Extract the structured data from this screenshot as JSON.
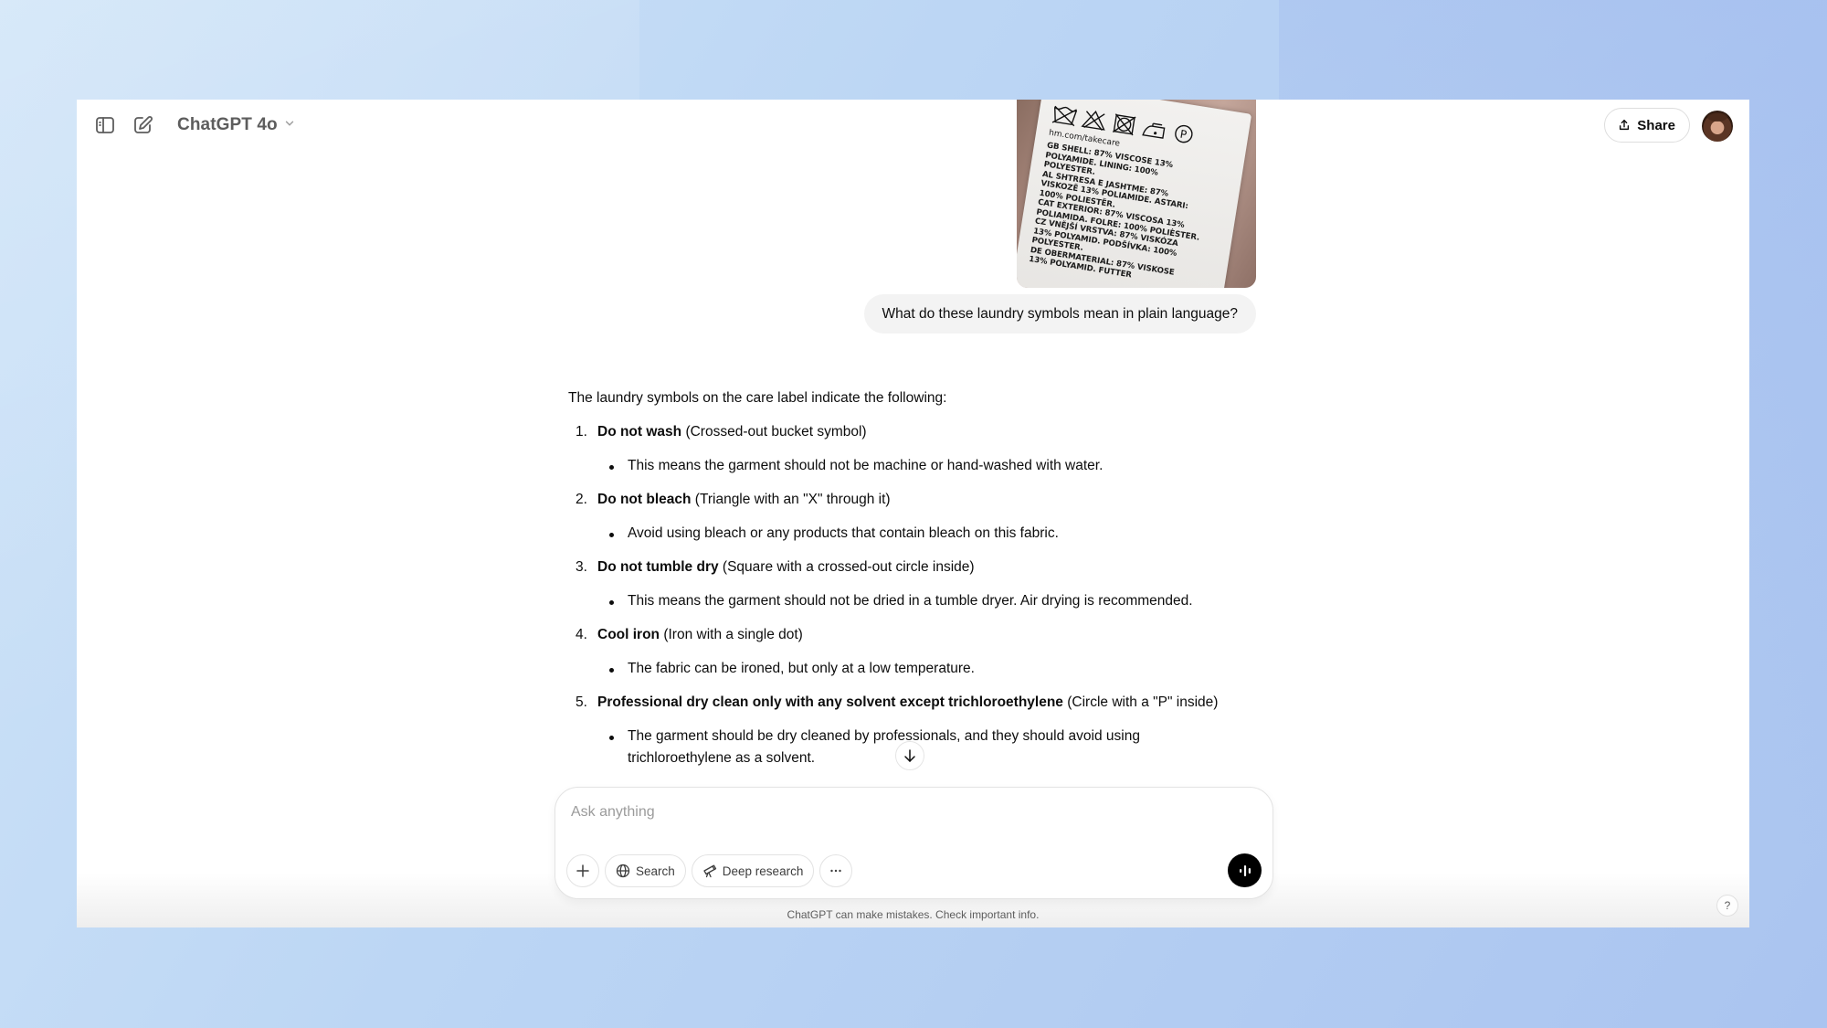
{
  "header": {
    "model_name": "ChatGPT 4o",
    "share_label": "Share",
    "icons": {
      "sidebar": "sidebar-toggle-icon",
      "new_chat": "new-chat-icon",
      "model_menu": "chevron-down-icon",
      "share": "share-upload-icon"
    }
  },
  "conversation": {
    "user_image": {
      "description": "Garment care label photo",
      "url_text": "hm.com/takecare",
      "label_lines": [
        "GB SHELL: 87% VISCOSE 13%",
        "POLYAMIDE. LINING: 100%",
        "POLYESTER.",
        "AL SHTRESA E JASHTME: 87%",
        "VISKOZË 13% POLIAMIDE. ASTARI:",
        "100% POLIESTËR.",
        "CAT EXTERIOR: 87% VISCOSA 13%",
        "POLIAMIDA. FOLRE: 100% POLIÈSTER.",
        "CZ VNĚJŠÍ VRSTVA: 87% VISKÓZA",
        "13% POLYAMID. PODŠÍVKA: 100%",
        "POLYESTER.",
        "DE OBERMATERIAL: 87% VISKOSE",
        "13% POLYAMID. FUTTER"
      ]
    },
    "user_message": "What do these laundry symbols mean in plain language?",
    "assistant": {
      "intro": "The laundry symbols on the care label indicate the following:",
      "items": [
        {
          "number": "1.",
          "title": "Do not wash",
          "note": " (Crossed-out bucket symbol)",
          "detail": "This means the garment should not be machine or hand-washed with water."
        },
        {
          "number": "2.",
          "title": "Do not bleach",
          "note": " (Triangle with an \"X\" through it)",
          "detail": "Avoid using bleach or any products that contain bleach on this fabric."
        },
        {
          "number": "3.",
          "title": "Do not tumble dry",
          "note": " (Square with a crossed-out circle inside)",
          "detail": "This means the garment should not be dried in a tumble dryer. Air drying is recommended."
        },
        {
          "number": "4.",
          "title": "Cool iron",
          "note": " (Iron with a single dot)",
          "detail": "The fabric can be ironed, but only at a low temperature."
        },
        {
          "number": "5.",
          "title": "Professional dry clean only with any solvent except trichloroethylene",
          "note": " (Circle with a \"P\" inside)",
          "detail": "The garment should be dry cleaned by professionals, and they should avoid using trichloroethylene as a solvent."
        }
      ]
    }
  },
  "composer": {
    "placeholder": "Ask anything",
    "value": "",
    "search_label": "Search",
    "deep_research_label": "Deep research"
  },
  "footer": {
    "disclaimer": "ChatGPT can make mistakes. Check important info.",
    "help_label": "?"
  }
}
